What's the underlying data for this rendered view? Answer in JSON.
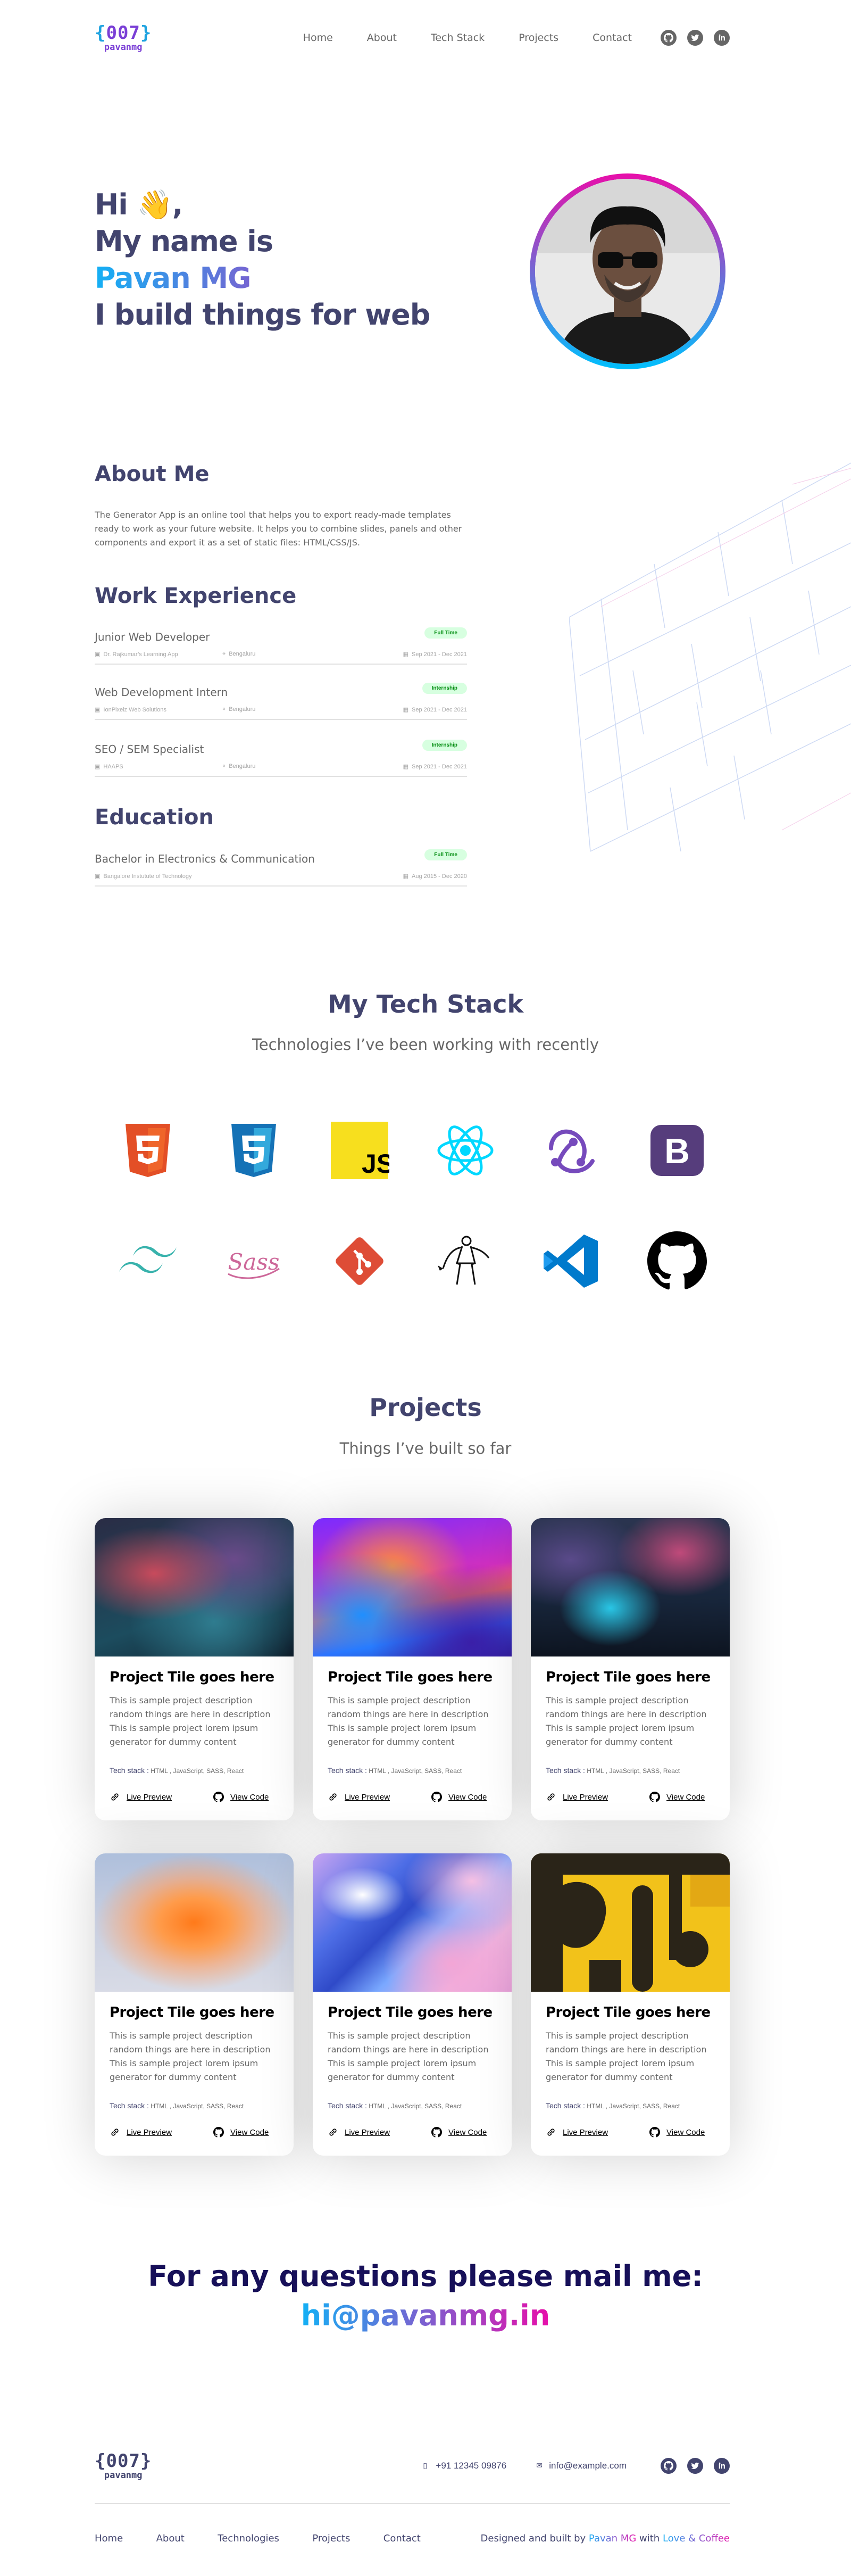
{
  "header": {
    "logo_code": "007",
    "logo_name": "pavanmg",
    "nav": [
      "Home",
      "About",
      "Tech Stack",
      "Projects",
      "Contact"
    ],
    "social_icons": [
      "github-icon",
      "twitter-icon",
      "linkedin-icon"
    ]
  },
  "hero": {
    "line1": "Hi 👋,",
    "line2": "My name is",
    "line3": "Pavan MG",
    "line4": "I build things for web"
  },
  "about": {
    "heading": "About Me",
    "text": "The Generator App is an online tool that helps you to export ready-made templates ready to work as your future website. It helps you to combine slides, panels and other components and export it as a set of static files: HTML/CSS/JS."
  },
  "work": {
    "heading": "Work Experience",
    "items": [
      {
        "role": "Junior Web Developer",
        "badge": "Full Time",
        "company": "Dr. Rajkumar’s Learning App",
        "location": "Bengaluru",
        "dates": "Sep 2021 - Dec 2021"
      },
      {
        "role": "Web Development Intern",
        "badge": "Internship",
        "company": "IonPixelz Web Solutions",
        "location": "Bengaluru",
        "dates": "Sep 2021 - Dec 2021"
      },
      {
        "role": "SEO / SEM Specialist",
        "badge": "Internship",
        "company": "HAAPS",
        "location": "Bengaluru",
        "dates": "Sep 2021 - Dec 2021"
      }
    ]
  },
  "education": {
    "heading": "Education",
    "items": [
      {
        "role": "Bachelor in Electronics & Communication",
        "badge": "Full Time",
        "company": "Bangalore Instutute of Technology",
        "location": "",
        "dates": "Aug 2015 - Dec 2020"
      }
    ]
  },
  "tech": {
    "heading": "My Tech Stack",
    "subheading": "Technologies I’ve been working with recently",
    "icons": [
      "html5-icon",
      "css3-icon",
      "javascript-icon",
      "react-icon",
      "redux-icon",
      "bootstrap-icon",
      "tailwind-icon",
      "sass-icon",
      "git-icon",
      "greensock-icon",
      "vscode-icon",
      "github-icon"
    ],
    "js_label": "JS",
    "bootstrap_label": "B",
    "sass_label": "Sass"
  },
  "projects": {
    "heading": "Projects",
    "subheading": "Things I’ve built so far",
    "items": [
      {
        "title": "Project Tile goes here",
        "desc": "This is sample project description random things are here in description This is sample project lorem ipsum generator for dummy content",
        "stack_label": "Tech stack :",
        "stack": " HTML , JavaScript, SASS, React",
        "live": "Live Preview",
        "code": "View Code"
      },
      {
        "title": "Project Tile goes here",
        "desc": "This is sample project description random things are here in description This is sample project lorem ipsum generator for dummy content",
        "stack_label": "Tech stack :",
        "stack": " HTML , JavaScript, SASS, React",
        "live": "Live Preview",
        "code": "View Code"
      },
      {
        "title": "Project Tile goes here",
        "desc": "This is sample project description random things are here in description This is sample project lorem ipsum generator for dummy content",
        "stack_label": "Tech stack :",
        "stack": " HTML , JavaScript, SASS, React",
        "live": "Live Preview",
        "code": "View Code"
      },
      {
        "title": "Project Tile goes here",
        "desc": "This is sample project description random things are here in description This is sample project lorem ipsum generator for dummy content",
        "stack_label": "Tech stack :",
        "stack": " HTML , JavaScript, SASS, React",
        "live": "Live Preview",
        "code": "View Code"
      },
      {
        "title": "Project Tile goes here",
        "desc": "This is sample project description random things are here in description This is sample project lorem ipsum generator for dummy content",
        "stack_label": "Tech stack :",
        "stack": " HTML , JavaScript, SASS, React",
        "live": "Live Preview",
        "code": "View Code"
      },
      {
        "title": "Project Tile goes here",
        "desc": "This is sample project description random things are here in description This is sample project lorem ipsum generator for dummy content",
        "stack_label": "Tech stack :",
        "stack": " HTML , JavaScript, SASS, React",
        "live": "Live Preview",
        "code": "View Code"
      }
    ]
  },
  "contact": {
    "question": "For any questions please mail me:",
    "email": "hi@pavanmg.in"
  },
  "footer": {
    "logo_code": "007",
    "logo_name": "pavanmg",
    "phone": "+91 12345 09876",
    "email": "info@example.com",
    "nav": [
      "Home",
      "About",
      "Technologies",
      "Projects",
      "Contact"
    ],
    "credit_prefix": "Designed and built by ",
    "credit_name": "Pavan MG",
    "credit_mid": " with ",
    "credit_love": "Love & Coffee"
  },
  "colors": {
    "heading": "#42446e",
    "body": "#666666",
    "gradient_start": "#13b0f5",
    "gradient_end": "#e70faa",
    "badge_bg": "#d7ffe0",
    "badge_text": "#018c0f"
  }
}
